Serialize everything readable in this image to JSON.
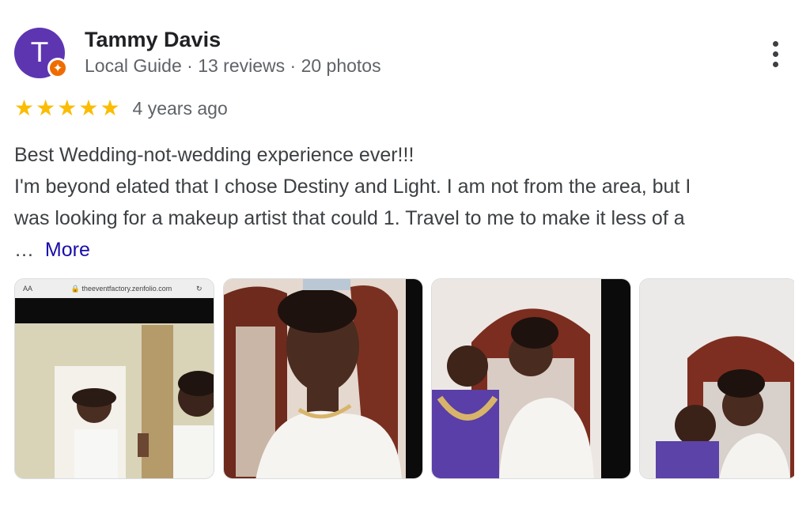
{
  "reviewer": {
    "initial": "T",
    "name": "Tammy Davis",
    "meta": "Local Guide · 13 reviews · 20 photos",
    "badge_icon": "local-guide-star-icon",
    "avatar_color": "#5e35b1",
    "badge_color": "#ef6c00"
  },
  "rating": {
    "stars": 5,
    "star_color": "#fbbc04",
    "time_ago": "4 years ago"
  },
  "review": {
    "lines": [
      "Best Wedding-not-wedding experience ever!!!",
      "I'm beyond elated that I chose Destiny and Light. I am not from the area, but I",
      "was looking for a makeup artist that could 1. Travel to me to make it less of a"
    ],
    "ellipsis": "…",
    "more_label": "More",
    "link_color": "#1a0dab"
  },
  "photos": {
    "first_photo_browser": {
      "text_size_label": "AA",
      "url": "theeventfactory.zenfolio.com"
    }
  }
}
